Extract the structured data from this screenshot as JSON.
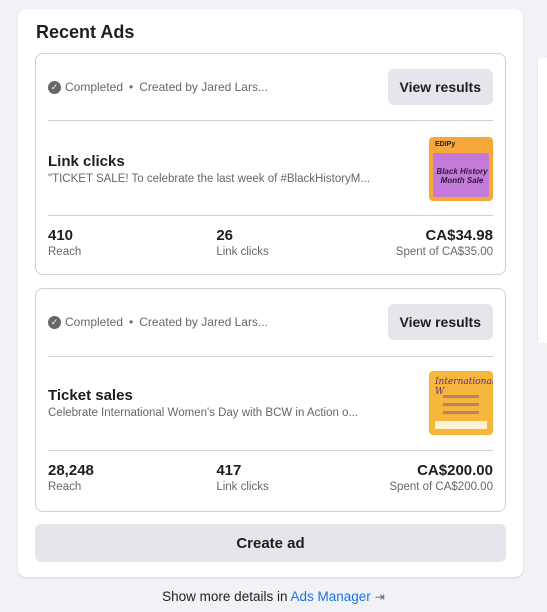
{
  "card": {
    "title": "Recent Ads"
  },
  "ads": [
    {
      "status": "Completed",
      "created_by": "Created by Jared Lars...",
      "view_label": "View results",
      "name": "Link clicks",
      "description": "\"TICKET SALE! To celebrate the last week of #BlackHistoryM...",
      "thumb_top": "EDIPy",
      "thumb_text": "Black History Month Sale",
      "stats": [
        {
          "value": "410",
          "label": "Reach"
        },
        {
          "value": "26",
          "label": "Link clicks"
        },
        {
          "value": "CA$34.98",
          "label": "Spent of CA$35.00"
        }
      ]
    },
    {
      "status": "Completed",
      "created_by": "Created by Jared Lars...",
      "view_label": "View results",
      "name": "Ticket sales",
      "description": "Celebrate International Women's Day with BCW in Action o...",
      "thumb_top": "International W",
      "stats": [
        {
          "value": "28,248",
          "label": "Reach"
        },
        {
          "value": "417",
          "label": "Link clicks"
        },
        {
          "value": "CA$200.00",
          "label": "Spent of CA$200.00"
        }
      ]
    }
  ],
  "create_label": "Create ad",
  "footer": {
    "prefix": "Show more details in",
    "link": "Ads Manager"
  },
  "colors": {
    "link": "#1b74e4",
    "button_bg": "#e4e6eb",
    "page_bg": "#f0f2f5"
  }
}
